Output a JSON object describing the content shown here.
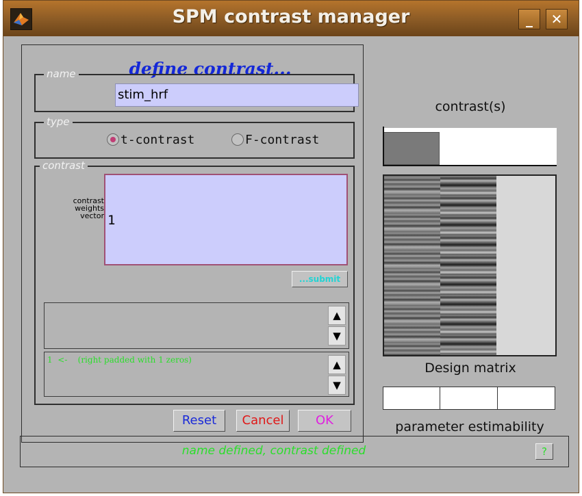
{
  "window": {
    "title": "SPM contrast manager",
    "minimize_label": "_",
    "close_label": "✕",
    "app_icon": "matlab-icon"
  },
  "form": {
    "heading": "define contrast...",
    "name_group_label": "name",
    "name_value": "stim_hrf",
    "type_group_label": "type",
    "type_options": [
      {
        "label": "t-contrast",
        "selected": true
      },
      {
        "label": "F-contrast",
        "selected": false
      }
    ],
    "contrast_group_label": "contrast",
    "weights_label_lines": [
      "contrast",
      "weights",
      "vector"
    ],
    "weights_value": "1",
    "submit_label": "...submit",
    "error_box_text": "",
    "info_box_text": "1  <-    (right padded with 1 zeros)"
  },
  "buttons": {
    "reset": "Reset",
    "cancel": "Cancel",
    "ok": "OK"
  },
  "right": {
    "contrast_title": "contrast(s)",
    "design_label": "Design matrix",
    "estimability_label": "parameter estimability"
  },
  "status": {
    "text": "name defined, contrast defined",
    "help_label": "?"
  },
  "colors": {
    "titlebar": "#8a5a25",
    "input_bg": "#cccdfc",
    "heading_blue": "#1428d8",
    "status_green": "#2bde2b",
    "reset_blue": "#1a2ad8",
    "cancel_red": "#e01818",
    "ok_magenta": "#e020e0"
  }
}
